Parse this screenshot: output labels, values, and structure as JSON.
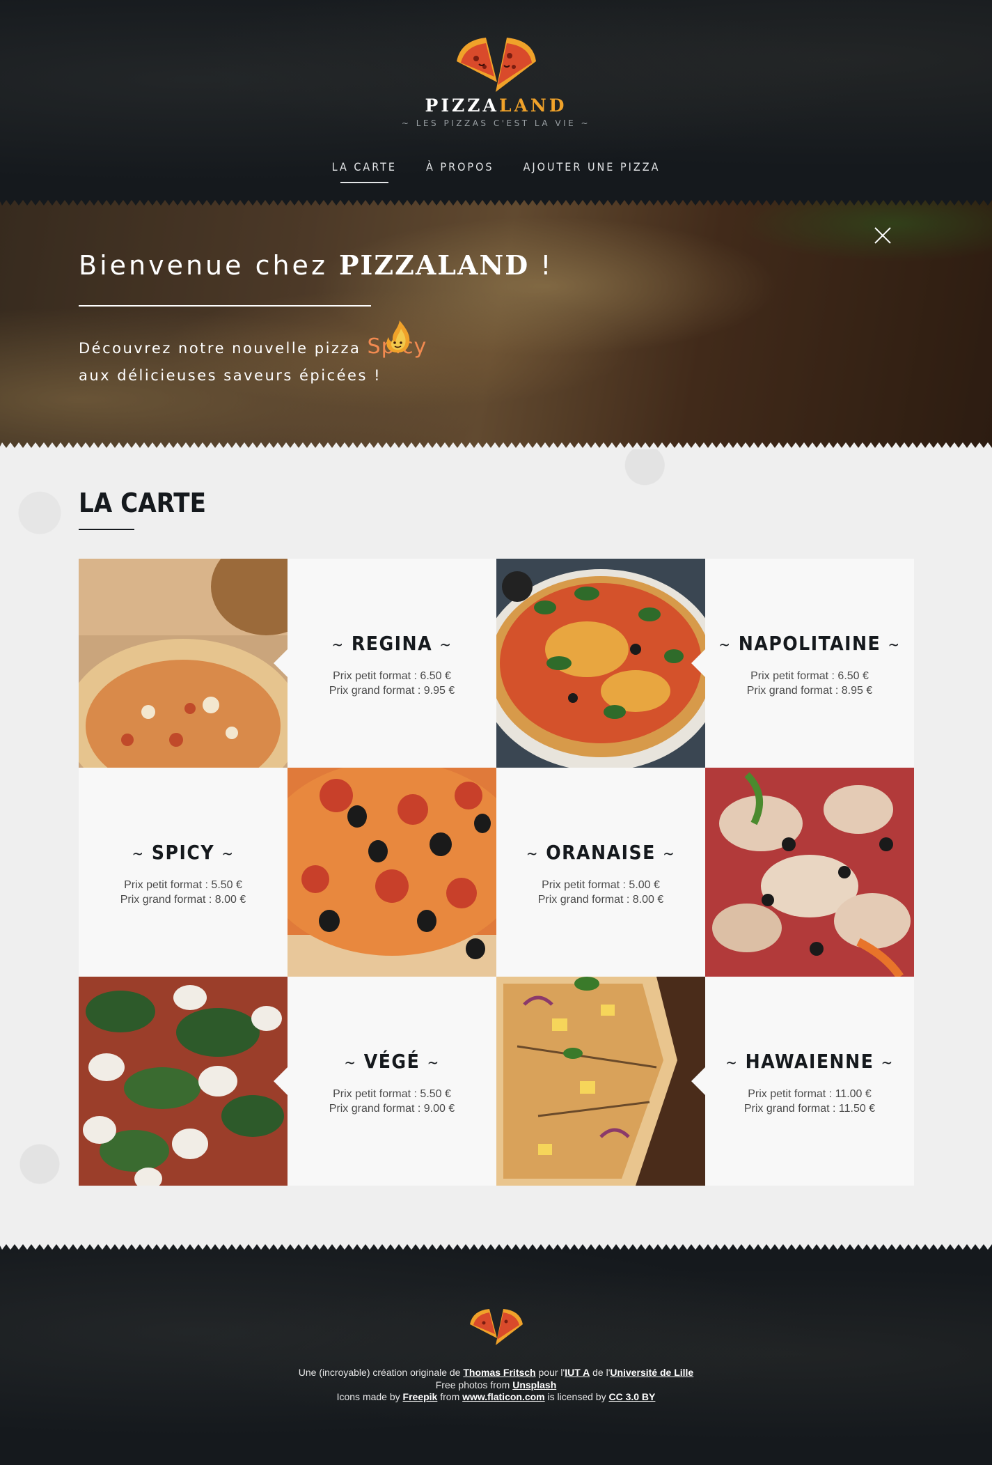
{
  "header": {
    "brand_part1": "PIZZA",
    "brand_part2": "LAND",
    "tagline": "~ LES PIZZAS C'EST LA VIE ~",
    "nav": [
      {
        "label": "LA CARTE",
        "active": true
      },
      {
        "label": "À PROPOS",
        "active": false
      },
      {
        "label": "AJOUTER UNE PIZZA",
        "active": false
      }
    ]
  },
  "hero": {
    "title_prefix": "Bienvenue chez",
    "title_brand_part1": "PIZZA",
    "title_brand_part2": "LAND",
    "title_suffix": "!",
    "line1_prefix": "Découvrez notre nouvelle pizza",
    "line1_accent": "Spicy",
    "line2": "aux délicieuses saveurs épicées !",
    "close_icon": "close-icon"
  },
  "menu": {
    "title": "LA CARTE",
    "pizzas": [
      {
        "name": "REGINA",
        "small": "Prix petit format : 6.50 €",
        "large": "Prix grand format : 9.95 €"
      },
      {
        "name": "NAPOLITAINE",
        "small": "Prix petit format : 6.50 €",
        "large": "Prix grand format : 8.95 €"
      },
      {
        "name": "SPICY",
        "small": "Prix petit format : 5.50 €",
        "large": "Prix grand format : 8.00 €"
      },
      {
        "name": "ORANAISE",
        "small": "Prix petit format : 5.00 €",
        "large": "Prix grand format : 8.00 €"
      },
      {
        "name": "VÉGÉ",
        "small": "Prix petit format : 5.50 €",
        "large": "Prix grand format : 9.00 €"
      },
      {
        "name": "HAWAIENNE",
        "small": "Prix petit format : 11.00 €",
        "large": "Prix grand format : 11.50 €"
      }
    ]
  },
  "footer": {
    "line1": {
      "t1": "Une (incroyable) création originale de",
      "author": "Thomas Fritsch",
      "t2": "pour l'",
      "school": "IUT A",
      "t3": "de l'",
      "university": "Université de Lille"
    },
    "line2": {
      "t1": "Free photos from",
      "source": "Unsplash"
    },
    "line3": {
      "t1": "Icons made by",
      "author": "Freepik",
      "t2": "from",
      "site": "www.flaticon.com",
      "t3": "is licensed by",
      "license": "CC 3.0 BY"
    }
  },
  "colors": {
    "dark": "#15191d",
    "accent_orange": "#f0a22a",
    "spicy_accent": "#f28a50",
    "card_bg": "#f8f8f8",
    "page_bg": "#efefef"
  }
}
